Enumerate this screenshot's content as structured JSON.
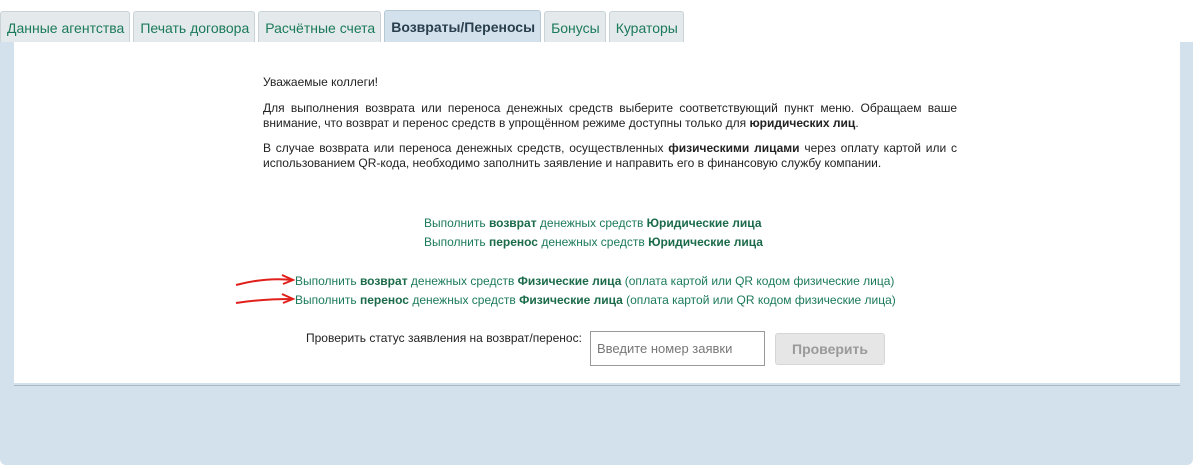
{
  "tabs": [
    {
      "label": "Данные агентства",
      "active": false
    },
    {
      "label": "Печать договора",
      "active": false
    },
    {
      "label": "Расчётные счета",
      "active": false
    },
    {
      "label": "Возвраты/Переносы",
      "active": true
    },
    {
      "label": "Бонусы",
      "active": false
    },
    {
      "label": "Кураторы",
      "active": false
    }
  ],
  "notice": {
    "greeting": "Уважаемые коллеги!",
    "p1_text": "Для выполнения возврата или переноса денежных средств выберите соответствующий пункт меню. Обращаем ваше внимание, что возврат и перенос средств в упрощённом режиме доступны только для ",
    "p1_bold": "юридических лиц",
    "p1_end": ".",
    "p2_text": "В случае возврата или переноса денежных средств, осуществленных ",
    "p2_bold": "физическими лицами",
    "p2_end": " через оплату картой или с использованием QR-кода, необходимо заполнить заявление и направить его в финансовую службу компании."
  },
  "links": {
    "refund_legal": {
      "pre": "Выполнить ",
      "bold1": "возврат",
      "mid": " денежных средств ",
      "bold2": "Юридические лица",
      "post": ""
    },
    "transfer_legal": {
      "pre": "Выполнить ",
      "bold1": "перенос",
      "mid": " денежных средств ",
      "bold2": "Юридические лица",
      "post": ""
    },
    "refund_individual": {
      "pre": "Выполнить ",
      "bold1": "возврат",
      "mid": " денежных средств ",
      "bold2": "Физические лица",
      "post": " (оплата картой или QR кодом физические лица)"
    },
    "transfer_individual": {
      "pre": "Выполнить ",
      "bold1": "перенос",
      "mid": " денежных средств ",
      "bold2": "Физические лица",
      "post": " (оплата картой или QR кодом физические лица)"
    }
  },
  "status_check": {
    "label": "Проверить статус заявления на возврат/перенос:",
    "placeholder": "Введите номер заявки",
    "value": "",
    "button_label": "Проверить"
  },
  "colors": {
    "link": "#1b7a5a",
    "panel": "#d3e1ec",
    "annotation_arrow": "#e0201b"
  }
}
